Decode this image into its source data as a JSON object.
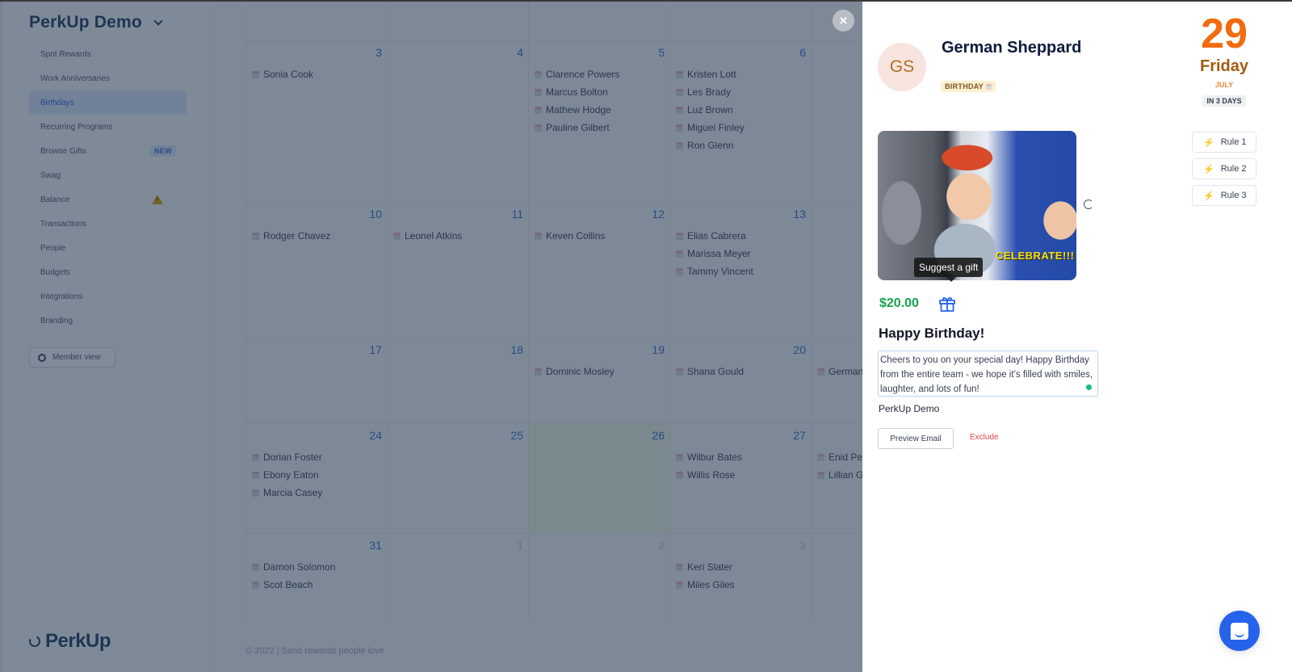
{
  "sidebar": {
    "org_name": "PerkUp Demo",
    "items": [
      {
        "label": "Spot Rewards"
      },
      {
        "label": "Work Anniversaries"
      },
      {
        "label": "Birthdays",
        "active": true
      },
      {
        "label": "Recurring Programs"
      },
      {
        "label": "Browse Gifts",
        "badge": "NEW"
      },
      {
        "label": "Swag"
      },
      {
        "label": "Balance",
        "icon": "warning-icon"
      },
      {
        "label": "Transactions"
      },
      {
        "label": "People"
      },
      {
        "label": "Budgets"
      },
      {
        "label": "Integrations"
      },
      {
        "label": "Branding"
      }
    ],
    "member_view_label": "Member view",
    "logo_text": "PerkUp"
  },
  "calendar": {
    "weeks": [
      {
        "days": [
          {
            "num": "3",
            "events": [
              "Sonia Cook"
            ]
          },
          {
            "num": "4",
            "events": []
          },
          {
            "num": "5",
            "events": [
              "Clarence Powers",
              "Marcus Bolton",
              "Mathew Hodge",
              "Pauline Gilbert"
            ]
          },
          {
            "num": "6",
            "events": [
              "Kristen Lott",
              "Les Brady",
              "Luz Brown",
              "Miguel Finley",
              "Ron Glenn"
            ]
          }
        ]
      },
      {
        "days": [
          {
            "num": "10",
            "events": [
              "Rodger Chavez"
            ]
          },
          {
            "num": "11",
            "events": [
              "Leonel Atkins"
            ]
          },
          {
            "num": "12",
            "events": [
              "Keven Collins"
            ]
          },
          {
            "num": "13",
            "events": [
              "Elias Cabrera",
              "Marissa Meyer",
              "Tammy Vincent"
            ]
          }
        ]
      },
      {
        "days": [
          {
            "num": "17",
            "events": []
          },
          {
            "num": "18",
            "events": []
          },
          {
            "num": "19",
            "events": [
              "Dominic Mosley"
            ]
          },
          {
            "num": "20",
            "events": [
              "Shana Gould"
            ]
          },
          {
            "num": "",
            "events": [
              "German Sheppard"
            ]
          }
        ]
      },
      {
        "days": [
          {
            "num": "24",
            "events": [
              "Dorian Foster",
              "Ebony Eaton",
              "Marcia Casey"
            ]
          },
          {
            "num": "25",
            "events": []
          },
          {
            "num": "26",
            "events": [],
            "today": true
          },
          {
            "num": "27",
            "events": [
              "Wilbur Bates",
              "Willis Rose"
            ]
          },
          {
            "num": "",
            "events": [
              "Enid Pe…",
              "Lillian G…"
            ]
          }
        ]
      },
      {
        "days": [
          {
            "num": "31",
            "events": [
              "Damon Solomon",
              "Scot Beach"
            ]
          },
          {
            "num": "1",
            "events": [],
            "other_month": true
          },
          {
            "num": "2",
            "events": [],
            "other_month": true
          },
          {
            "num": "3",
            "events": [
              "Keri Slater",
              "Miles Giles"
            ],
            "other_month": true
          }
        ]
      }
    ],
    "footer": "© 2022 | Send rewards people love"
  },
  "drawer": {
    "close_label": "×",
    "avatar_initials": "GS",
    "person_name": "German Sheppard",
    "occasion_badge": "BIRTHDAY",
    "date": {
      "day": "29",
      "weekday": "Friday",
      "month": "JULY",
      "days_until": "IN 3 DAYS"
    },
    "rules": [
      {
        "label": "Rule 1"
      },
      {
        "label": "Rule 2"
      },
      {
        "label": "Rule 3"
      }
    ],
    "gif_caption": "CELEBRATE!!!",
    "tooltip": "Suggest a gift",
    "amount": "$20.00",
    "message_title": "Happy Birthday!",
    "message_body": "Cheers to you on your special day! Happy Birthday from the entire team - we hope it’s filled with smiles, laughter, and lots of fun!",
    "sender": "PerkUp Demo",
    "preview_email_label": "Preview Email",
    "exclude_label": "Exclude"
  },
  "colors": {
    "accent": "#2563eb",
    "amount": "#16a34a",
    "date_day": "#f26b0f",
    "exclude": "#e04848"
  }
}
